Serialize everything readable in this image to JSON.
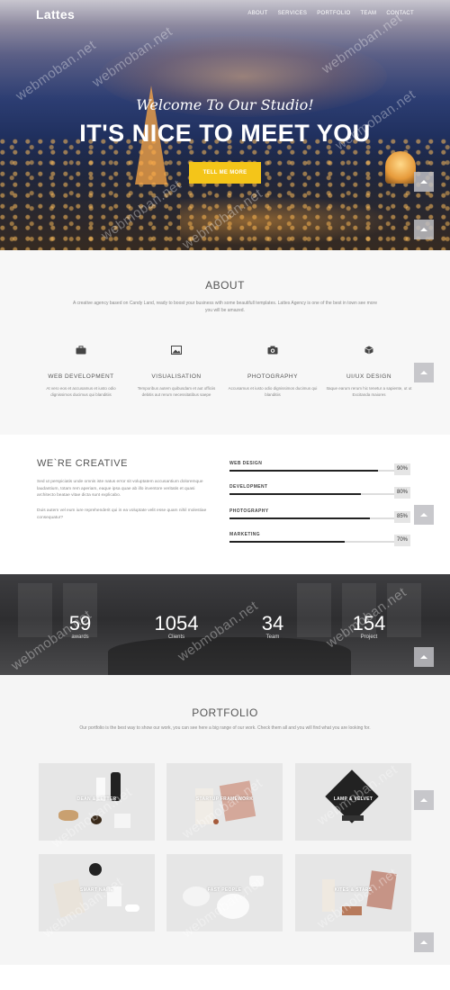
{
  "nav": {
    "logo": "Lattes",
    "items": [
      "ABOUT",
      "SERVICES",
      "PORTFOLIO",
      "TEAM",
      "CONTACT"
    ]
  },
  "hero": {
    "welcome": "Welcome To Our Studio!",
    "title": "IT'S NICE TO MEET YOU",
    "button": "TELL ME MORE"
  },
  "watermark": "webmoban.net",
  "about": {
    "title": "ABOUT",
    "subtitle": "A creative agency based on Candy Land, ready to boost your business with some beautifull templates. Lattes Agency is one of the best in town see more you will be amazed.",
    "services": [
      {
        "icon": "briefcase-icon",
        "title": "WEB DEVELOPMENT",
        "desc": "At vero eos et accusamus et iusto odio dignissimos ducimus qui blanditiis"
      },
      {
        "icon": "picture-icon",
        "title": "VISUALISATION",
        "desc": "Temporibus autem quibusdam et aut officiis debitis aut rerum necessitatibus saepe"
      },
      {
        "icon": "camera-icon",
        "title": "PHOTOGRAPHY",
        "desc": "Accusamus et iusto odio dignissimos ducimus qui blanditiis"
      },
      {
        "icon": "cube-icon",
        "title": "UI/UX DESIGN",
        "desc": "Itaque earum rerum hic tenetur a sapiente, ut ut Excitanda maiores"
      }
    ]
  },
  "creative": {
    "title": "WE`RE CREATIVE",
    "para1": "Sed ut perspiciatis unde omnis iste natus error sit voluptatem accusantium doloremque laudantium, totam rem aperiam, eaque ipsa quae ab illo inventore veritatis et quasi architecto beatae vitae dicta sunt explicabo.",
    "para2": "Duis autem vel eum iure reprehenderit qui in ea voluptate velit esse quam nihil molestiae consequatur?",
    "skills": [
      {
        "label": "WEB DESIGN",
        "value": "90%",
        "fraction": 0.9
      },
      {
        "label": "DEVELOPMENT",
        "value": "80%",
        "fraction": 0.8
      },
      {
        "label": "PHOTOGRAPHY",
        "value": "85%",
        "fraction": 0.85
      },
      {
        "label": "MARKETING",
        "value": "70%",
        "fraction": 0.7
      }
    ]
  },
  "stats": [
    {
      "num": "59",
      "label": "awards"
    },
    {
      "num": "1054",
      "label": "Clients"
    },
    {
      "num": "34",
      "label": "Team"
    },
    {
      "num": "154",
      "label": "Project"
    }
  ],
  "portfolio": {
    "title": "PORTFOLIO",
    "subtitle": "Our portfolio is the best way to show our work, you can see here a big range of our work. Check them all and you will find what you are looking for.",
    "items": [
      {
        "label": "DEAN & LETTER"
      },
      {
        "label": "STARTUP FRAMEWORK"
      },
      {
        "label": "LAMP & VELVET"
      },
      {
        "label": "SMART NAME"
      },
      {
        "label": "FAST PEOPLE"
      },
      {
        "label": "KITES & STARS"
      }
    ]
  },
  "colors": {
    "accent": "#f4c519",
    "scroll_button": "#bebec3",
    "section_gray": "#f7f7f7"
  }
}
